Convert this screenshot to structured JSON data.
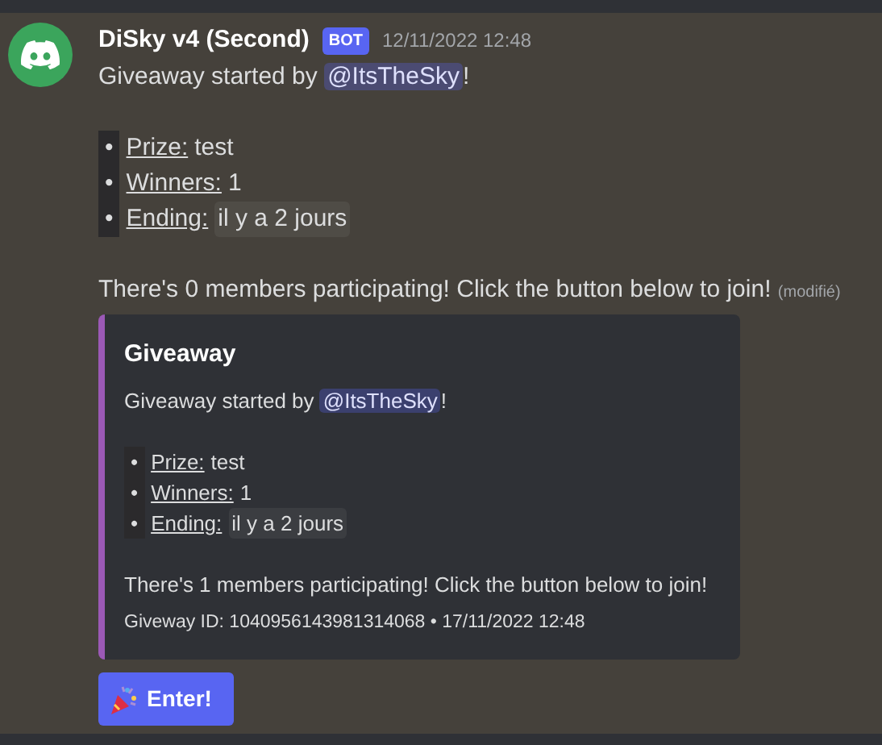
{
  "message": {
    "author": "DiSky v4 (Second)",
    "tag": "BOT",
    "timestamp": "12/11/2022 12:48",
    "intro": {
      "text": "Giveaway started by",
      "mention": "@ItsTheSky",
      "suffix": "!"
    },
    "items": [
      {
        "bullet": "•",
        "label": "Prize:",
        "value": "test",
        "kind": "text"
      },
      {
        "bullet": "•",
        "label": "Winners:",
        "value": "1",
        "kind": "text"
      },
      {
        "bullet": "•",
        "label": "Ending:",
        "value": "il y a 2 jours",
        "kind": "timestamp"
      }
    ],
    "text": "There's 0 members participating! Click the button below to join!",
    "edited": "(modifié)",
    "embed": {
      "color": "#9b59b6",
      "title": "Giveaway",
      "intro": {
        "text": "Giveaway started by",
        "mention": "@ItsTheSky",
        "suffix": "!"
      },
      "items": [
        {
          "bullet": "•",
          "label": "Prize:",
          "value": "test",
          "kind": "text"
        },
        {
          "bullet": "•",
          "label": "Winners:",
          "value": "1",
          "kind": "text"
        },
        {
          "bullet": "•",
          "label": "Ending:",
          "value": "il y a 2 jours",
          "kind": "timestamp"
        }
      ],
      "text": "There's 1 members participating! Click the button below to join!",
      "footer": "Giveway ID: 1040956143981314068 • 17/11/2022 12:48"
    },
    "button": {
      "label": "Enter!"
    }
  }
}
